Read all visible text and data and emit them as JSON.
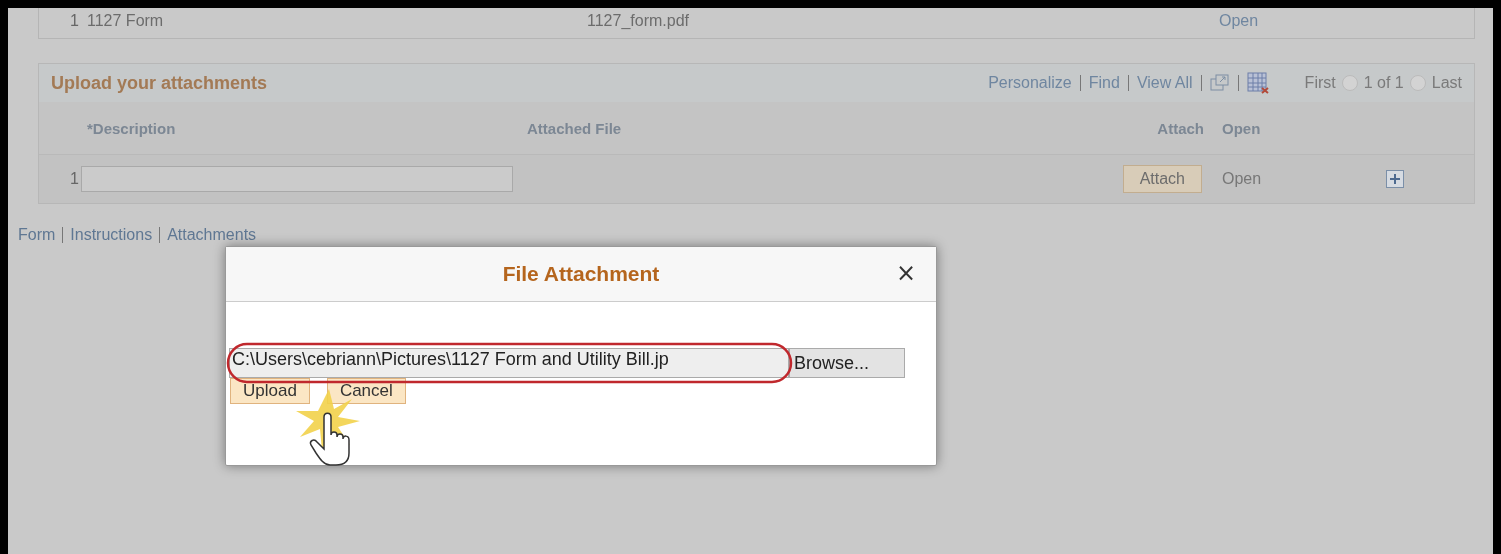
{
  "top_table": {
    "row": {
      "number": "1",
      "description": "1127 Form",
      "file": "1127_form.pdf",
      "open": "Open"
    }
  },
  "attachments_grid": {
    "title": "Upload your attachments",
    "toolbar": {
      "personalize": "Personalize",
      "find": "Find",
      "view_all": "View All",
      "first": "First",
      "page": "1 of 1",
      "last": "Last"
    },
    "columns": [
      "*Description",
      "Attached File",
      "Attach",
      "Open"
    ],
    "rows": [
      {
        "number": "1",
        "description": "",
        "attach": "Attach",
        "open": "Open"
      }
    ]
  },
  "nav_links": [
    "Form",
    "Instructions",
    "Attachments"
  ],
  "dialog": {
    "title": "File Attachment",
    "close": "×",
    "file_path": "C:\\Users\\cebriann\\Pictures\\1127 Form and Utility Bill.jp",
    "browse": "Browse...",
    "buttons": [
      "Upload",
      "Cancel"
    ]
  }
}
